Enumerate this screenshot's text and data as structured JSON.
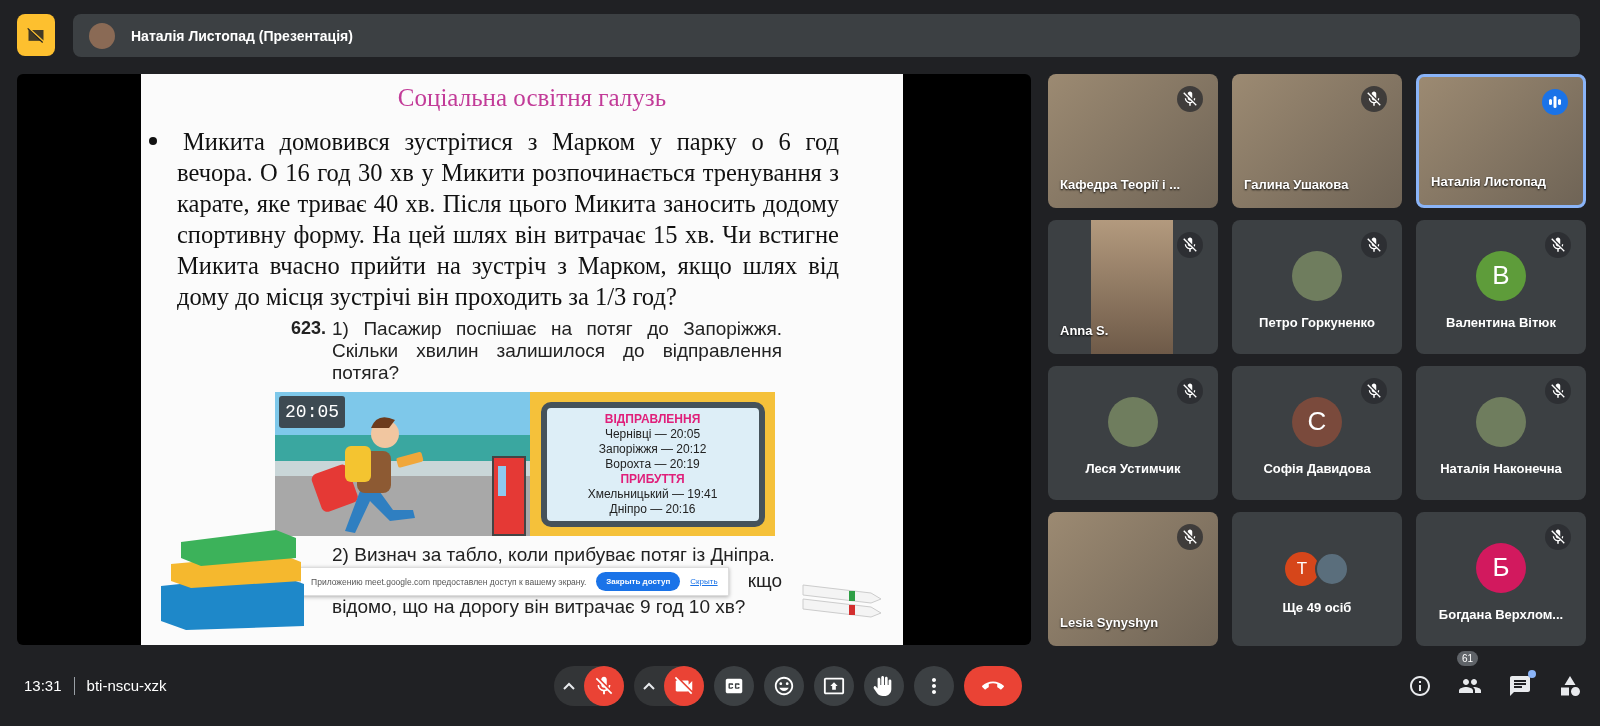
{
  "top_bar": {
    "presenter": "Наталія Листопад (Презентація)"
  },
  "slide": {
    "title": "Соціальна освітня галузь",
    "bullet_text": "Микита домовився зустрітися з Марком у парку о 6 год вечора. О 16 год 30 хв у Микити розпочинається тренування з карате, яке триває 40 хв. Після цього Микита заносить додому спортивну форму. На цей шлях він витрачає 15 хв. Чи встигне Микита вчасно прийти на зустріч з Марком, якщо шлях від дому до місця зустрічі він проходить за 1/3 год?",
    "exercise": {
      "number": "623.",
      "item_1": "1) Пасажир поспішає на потяг до Запоріжжя. Скільки хвилин залишилося до відправлення потяга?",
      "clock": "20:05",
      "board": {
        "departures_title": "ВІДПРАВЛЕННЯ",
        "departures": [
          "Чернівці — 20:05",
          "Запоріжжя — 20:12",
          "Ворохта — 20:19"
        ],
        "arrivals_title": "ПРИБУТТЯ",
        "arrivals": [
          "Хмельницький — 19:41",
          "Дніпро — 20:16"
        ]
      },
      "item_2": "2) Визнач за табло, коли прибуває потяг із Дніпра.",
      "item_2_tail": "кщо",
      "item_2_last": "відомо, що на дорогу він витрачає 9 год 10 хв?"
    },
    "share_banner": {
      "message": "Приложению meet.google.com предоставлен доступ к вашему экрану.",
      "stop_button": "Закрыть доступ",
      "hide_link": "Скрыть"
    }
  },
  "participants": [
    {
      "name": "Кафедра Теорії і ...",
      "kind": "video",
      "muted": true,
      "speaking": false
    },
    {
      "name": "Галина Ушакова",
      "kind": "video",
      "muted": true,
      "speaking": false
    },
    {
      "name": "Наталія Листопад",
      "kind": "video",
      "muted": false,
      "speaking": true
    },
    {
      "name": "Anna S.",
      "kind": "narrow_video",
      "muted": true,
      "speaking": false
    },
    {
      "name": "Петро Горкуненко",
      "kind": "photo",
      "muted": true,
      "speaking": false
    },
    {
      "name": "Валентина Вітюк",
      "kind": "letter",
      "letter": "В",
      "color": "#5e9c3a",
      "muted": true,
      "speaking": false
    },
    {
      "name": "Леся Устимчик",
      "kind": "photo",
      "muted": true,
      "speaking": false
    },
    {
      "name": "Софія Давидова",
      "kind": "letter",
      "letter": "С",
      "color": "#7a4a3c",
      "muted": true,
      "speaking": false
    },
    {
      "name": "Наталія Наконечна",
      "kind": "photo",
      "muted": true,
      "speaking": false
    },
    {
      "name": "Lesia Synyshyn",
      "kind": "video",
      "muted": true,
      "speaking": false
    },
    {
      "name": "Ще 49 осіб",
      "kind": "more",
      "letter": "Т",
      "color": "#d6461a",
      "muted": false,
      "speaking": false
    },
    {
      "name": "Богдана Верхлом...",
      "kind": "letter",
      "letter": "Б",
      "color": "#d2195e",
      "muted": true,
      "speaking": false
    }
  ],
  "bottom_bar": {
    "time": "13:31",
    "meeting_code": "bti-nscu-xzk",
    "controls": [
      {
        "kind": "mic",
        "on": false
      },
      {
        "kind": "camera",
        "on": false
      },
      {
        "kind": "captions"
      },
      {
        "kind": "emoji"
      },
      {
        "kind": "present"
      },
      {
        "kind": "hand"
      },
      {
        "kind": "more"
      },
      {
        "kind": "end"
      }
    ],
    "side": [
      {
        "kind": "info"
      },
      {
        "kind": "people",
        "badge": "61"
      },
      {
        "kind": "chat",
        "unread": true
      },
      {
        "kind": "activities"
      }
    ]
  }
}
